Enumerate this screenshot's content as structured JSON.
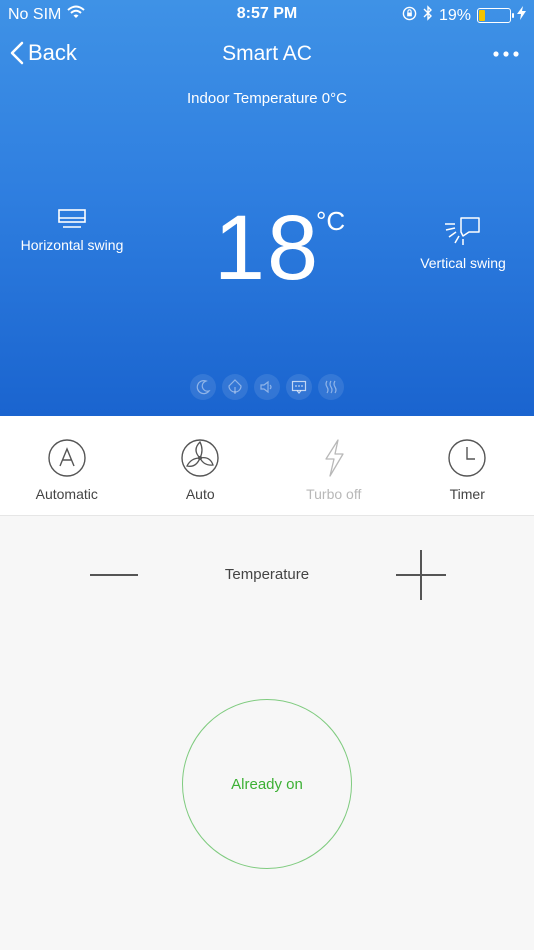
{
  "status_bar": {
    "carrier": "No SIM",
    "time": "8:57 PM",
    "battery_percent": "19%",
    "battery_level": 0.19,
    "icons": [
      "wifi-icon",
      "rotation-lock-icon",
      "bluetooth-icon",
      "battery-icon",
      "charging-bolt-icon"
    ]
  },
  "nav": {
    "back_label": "Back",
    "title": "Smart AC",
    "more_icon": "more-dots-icon"
  },
  "indoor": {
    "label": "Indoor Temperature 0°C"
  },
  "setpoint": {
    "value": "18",
    "unit": "°C"
  },
  "swing": {
    "horizontal_label": "Horizontal swing",
    "vertical_label": "Vertical swing"
  },
  "quick_icons": [
    "moon-icon",
    "leaf-icon",
    "speaker-icon",
    "display-icon",
    "heat-icon"
  ],
  "modes": [
    {
      "label": "Automatic",
      "icon": "mode-a-icon",
      "enabled": true
    },
    {
      "label": "Auto",
      "icon": "fan-icon",
      "enabled": true
    },
    {
      "label": "Turbo off",
      "icon": "lightning-icon",
      "enabled": false
    },
    {
      "label": "Timer",
      "icon": "clock-icon",
      "enabled": true
    }
  ],
  "temperature_control": {
    "label": "Temperature"
  },
  "power": {
    "label": "Already on"
  },
  "colors": {
    "hero_top": "#3f92e6",
    "hero_bottom": "#1a64cf",
    "power_green": "#3cb034",
    "power_ring": "#7fcb7f",
    "battery_yellow": "#f5c400"
  }
}
